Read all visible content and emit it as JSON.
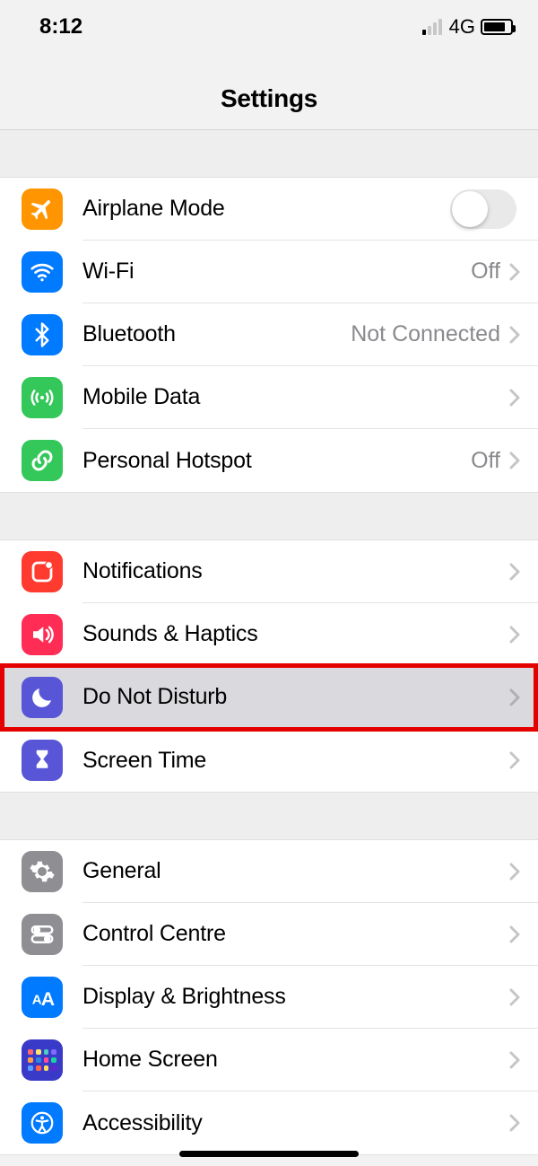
{
  "status": {
    "time": "8:12",
    "network_label": "4G"
  },
  "header": {
    "title": "Settings"
  },
  "groups": [
    {
      "items": [
        {
          "id": "airplane",
          "label": "Airplane Mode",
          "accessory": "switch",
          "icon": "airplane-icon",
          "icon_bg": "bg-orange",
          "switch_on": false
        },
        {
          "id": "wifi",
          "label": "Wi-Fi",
          "value": "Off",
          "accessory": "disclosure",
          "icon": "wifi-icon",
          "icon_bg": "bg-blue"
        },
        {
          "id": "bluetooth",
          "label": "Bluetooth",
          "value": "Not Connected",
          "accessory": "disclosure",
          "icon": "bluetooth-icon",
          "icon_bg": "bg-blue"
        },
        {
          "id": "mobiledata",
          "label": "Mobile Data",
          "accessory": "disclosure",
          "icon": "antenna-icon",
          "icon_bg": "bg-green"
        },
        {
          "id": "hotspot",
          "label": "Personal Hotspot",
          "value": "Off",
          "accessory": "disclosure",
          "icon": "link-icon",
          "icon_bg": "bg-green"
        }
      ]
    },
    {
      "items": [
        {
          "id": "notifications",
          "label": "Notifications",
          "accessory": "disclosure",
          "icon": "notification-icon",
          "icon_bg": "bg-red"
        },
        {
          "id": "sounds",
          "label": "Sounds & Haptics",
          "accessory": "disclosure",
          "icon": "speaker-icon",
          "icon_bg": "bg-pink"
        },
        {
          "id": "dnd",
          "label": "Do Not Disturb",
          "accessory": "disclosure",
          "icon": "moon-icon",
          "icon_bg": "bg-purple",
          "highlighted": true
        },
        {
          "id": "screentime",
          "label": "Screen Time",
          "accessory": "disclosure",
          "icon": "hourglass-icon",
          "icon_bg": "bg-purple"
        }
      ]
    },
    {
      "items": [
        {
          "id": "general",
          "label": "General",
          "accessory": "disclosure",
          "icon": "gear-icon",
          "icon_bg": "bg-gray"
        },
        {
          "id": "controlcentre",
          "label": "Control Centre",
          "accessory": "disclosure",
          "icon": "toggles-icon",
          "icon_bg": "bg-gray"
        },
        {
          "id": "display",
          "label": "Display & Brightness",
          "accessory": "disclosure",
          "icon": "text-size-icon",
          "icon_bg": "bg-blue"
        },
        {
          "id": "homescreen",
          "label": "Home Screen",
          "accessory": "disclosure",
          "icon": "home-grid-icon",
          "icon_bg": "bg-blue"
        },
        {
          "id": "accessibility",
          "label": "Accessibility",
          "accessory": "disclosure",
          "icon": "accessibility-icon",
          "icon_bg": "bg-blue2"
        }
      ]
    }
  ]
}
